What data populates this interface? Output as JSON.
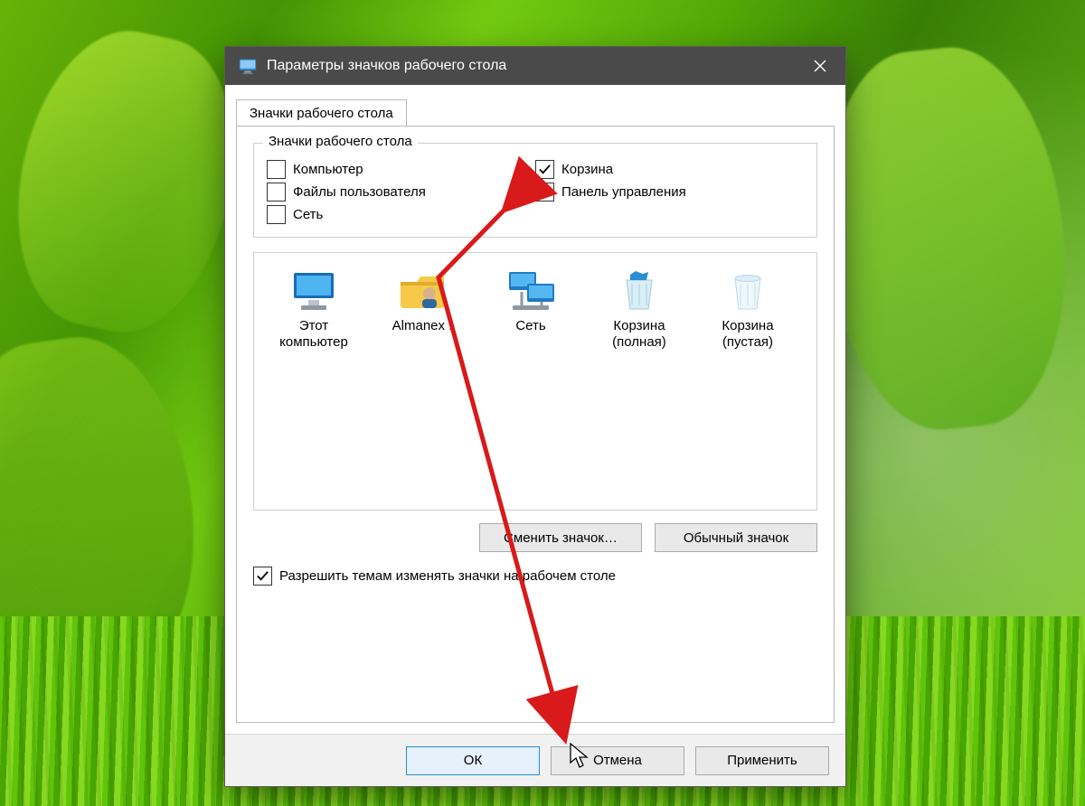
{
  "window": {
    "title": "Параметры значков рабочего стола"
  },
  "tab": {
    "label": "Значки рабочего стола"
  },
  "group": {
    "title": "Значки рабочего стола",
    "checkboxes": {
      "computer": {
        "label": "Компьютер",
        "checked": false
      },
      "userfiles": {
        "label": "Файлы пользователя",
        "checked": false
      },
      "network": {
        "label": "Сеть",
        "checked": false
      },
      "recyclebin": {
        "label": "Корзина",
        "checked": true
      },
      "controlpanel": {
        "label": "Панель управления",
        "checked": true
      }
    }
  },
  "icons": {
    "this_pc": {
      "label": "Этот компьютер"
    },
    "user_folder": {
      "label": "Almanex ."
    },
    "network": {
      "label": "Сеть"
    },
    "recycle_full": {
      "label": "Корзина (полная)"
    },
    "recycle_empty": {
      "label": "Корзина (пустая)"
    }
  },
  "buttons": {
    "change_icon": "Сменить значок…",
    "default_icon": "Обычный значок",
    "ok": "ОК",
    "cancel": "Отмена",
    "apply": "Применить"
  },
  "allow_themes": {
    "label": "Разрешить темам изменять значки на рабочем столе",
    "checked": true
  },
  "colors": {
    "annotation": "#d81a1a"
  }
}
